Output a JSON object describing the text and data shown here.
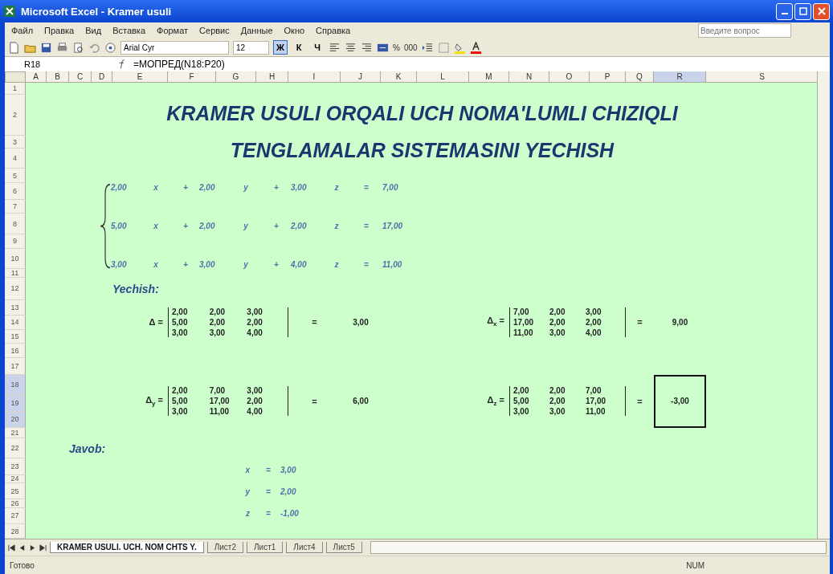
{
  "window": {
    "title": "Microsoft Excel - Kramer usuli"
  },
  "menu": [
    "Файл",
    "Правка",
    "Вид",
    "Вставка",
    "Формат",
    "Сервис",
    "Данные",
    "Окно",
    "Справка"
  ],
  "help_search": {
    "placeholder": "Введите вопрос"
  },
  "toolbar": {
    "font": "Arial Cyr",
    "size": "12",
    "format_buttons": [
      {
        "label": "Ж",
        "selected": true
      },
      {
        "label": "К",
        "selected": false
      },
      {
        "label": "Ч",
        "selected": false
      }
    ],
    "percent": "%",
    "thousands": "000"
  },
  "formula_bar": {
    "cell": "R18",
    "formula": "=МОПРЕД(N18:P20)"
  },
  "columns": [
    {
      "label": "A",
      "selected": false
    },
    {
      "label": "B",
      "selected": false
    },
    {
      "label": "C",
      "selected": false
    },
    {
      "label": "D",
      "selected": false
    },
    {
      "label": "E",
      "selected": false
    },
    {
      "label": "F",
      "selected": false
    },
    {
      "label": "G",
      "selected": false
    },
    {
      "label": "H",
      "selected": false
    },
    {
      "label": "I",
      "selected": false
    },
    {
      "label": "J",
      "selected": false
    },
    {
      "label": "K",
      "selected": false
    },
    {
      "label": "L",
      "selected": false
    },
    {
      "label": "M",
      "selected": false
    },
    {
      "label": "N",
      "selected": false
    },
    {
      "label": "O",
      "selected": false
    },
    {
      "label": "P",
      "selected": false
    },
    {
      "label": "Q",
      "selected": false
    },
    {
      "label": "R",
      "selected": true
    },
    {
      "label": "S",
      "selected": false
    }
  ],
  "rows": [
    {
      "label": "1",
      "selected": false
    },
    {
      "label": "2",
      "selected": false
    },
    {
      "label": "3",
      "selected": false
    },
    {
      "label": "4",
      "selected": false
    },
    {
      "label": "5",
      "selected": false
    },
    {
      "label": "6",
      "selected": false
    },
    {
      "label": "7",
      "selected": false
    },
    {
      "label": "8",
      "selected": false
    },
    {
      "label": "9",
      "selected": false
    },
    {
      "label": "10",
      "selected": false
    },
    {
      "label": "11",
      "selected": false
    },
    {
      "label": "12",
      "selected": false
    },
    {
      "label": "13",
      "selected": false
    },
    {
      "label": "14",
      "selected": false
    },
    {
      "label": "15",
      "selected": false
    },
    {
      "label": "16",
      "selected": false
    },
    {
      "label": "17",
      "selected": false
    },
    {
      "label": "18",
      "selected": true
    },
    {
      "label": "19",
      "selected": true
    },
    {
      "label": "20",
      "selected": true
    },
    {
      "label": "21",
      "selected": false
    },
    {
      "label": "22",
      "selected": false
    },
    {
      "label": "23",
      "selected": false
    },
    {
      "label": "24",
      "selected": false
    },
    {
      "label": "25",
      "selected": false
    },
    {
      "label": "26",
      "selected": false
    },
    {
      "label": "27",
      "selected": false
    },
    {
      "label": "28",
      "selected": false
    }
  ],
  "sheet": {
    "title": [
      "KRAMER  USULI  ORQALI  UCH  NOMA'LUMLI  CHIZIQLI",
      "TENGLAMALAR SISTEMASINI  YECHISH"
    ],
    "system": [
      {
        "a": "2,00",
        "x": "x",
        "op1": "+",
        "b": "2,00",
        "y": "y",
        "op2": "+",
        "c": "3,00",
        "z": "z",
        "eq": "=",
        "rhs": "7,00"
      },
      {
        "a": "5,00",
        "x": "x",
        "op1": "+",
        "b": "2,00",
        "y": "y",
        "op2": "+",
        "c": "2,00",
        "z": "z",
        "eq": "=",
        "rhs": "17,00"
      },
      {
        "a": "3,00",
        "x": "x",
        "op1": "+",
        "b": "3,00",
        "y": "y",
        "op2": "+",
        "c": "4,00",
        "z": "z",
        "eq": "=",
        "rhs": "11,00"
      }
    ],
    "solution_label": "Yechish:",
    "determinants": [
      {
        "symbol": "Δ",
        "eq": "=",
        "matrix": [
          [
            "2,00",
            "2,00",
            "3,00"
          ],
          [
            "5,00",
            "2,00",
            "2,00"
          ],
          [
            "3,00",
            "3,00",
            "4,00"
          ]
        ],
        "eq2": "=",
        "value": "3,00",
        "selected": false
      },
      {
        "symbol": "Δ",
        "sub": "x",
        "eq": "=",
        "matrix": [
          [
            "7,00",
            "2,00",
            "3,00"
          ],
          [
            "17,00",
            "2,00",
            "2,00"
          ],
          [
            "11,00",
            "3,00",
            "4,00"
          ]
        ],
        "eq2": "=",
        "value": "9,00",
        "selected": false
      },
      {
        "symbol": "Δ",
        "sub": "y",
        "eq": "=",
        "matrix": [
          [
            "2,00",
            "7,00",
            "3,00"
          ],
          [
            "5,00",
            "17,00",
            "2,00"
          ],
          [
            "3,00",
            "11,00",
            "4,00"
          ]
        ],
        "eq2": "=",
        "value": "6,00",
        "selected": false
      },
      {
        "symbol": "Δ",
        "sub": "z",
        "eq": "=",
        "matrix": [
          [
            "2,00",
            "2,00",
            "7,00"
          ],
          [
            "5,00",
            "2,00",
            "17,00"
          ],
          [
            "3,00",
            "3,00",
            "11,00"
          ]
        ],
        "eq2": "=",
        "value": "-3,00",
        "selected": true
      }
    ],
    "answer_label": "Javob:",
    "answers": [
      {
        "var": "x",
        "eq": "=",
        "value": "3,00"
      },
      {
        "var": "y",
        "eq": "=",
        "value": "2,00"
      },
      {
        "var": "z",
        "eq": "=",
        "value": "-1,00"
      }
    ]
  },
  "sheet_tabs": [
    {
      "label": "KRAMER USULI. UCH. NOM CHTS Y.",
      "selected": true
    },
    {
      "label": "Лист2",
      "selected": false
    },
    {
      "label": "Лист1",
      "selected": false
    },
    {
      "label": "Лист4",
      "selected": false
    },
    {
      "label": "Лист5",
      "selected": false
    }
  ],
  "status_bar": {
    "state": "Готово",
    "num": "NUM"
  }
}
